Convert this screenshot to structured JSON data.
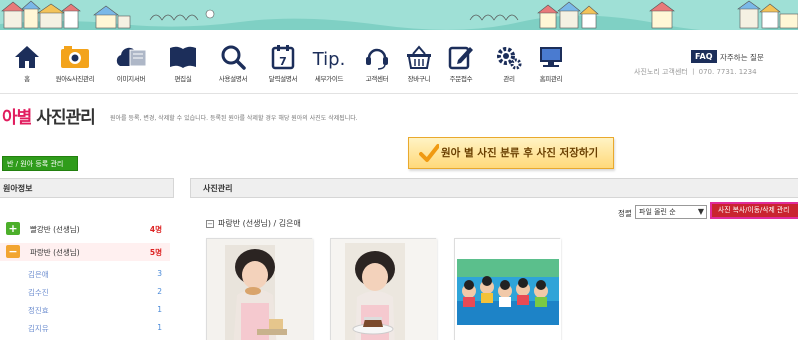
{
  "nav": {
    "items": [
      {
        "label": "홈",
        "icon": "home-icon"
      },
      {
        "label": "원아&사진관리",
        "icon": "camera-icon"
      },
      {
        "label": "이미지서버",
        "icon": "cloud-server-icon"
      },
      {
        "label": "편집실",
        "icon": "book-icon"
      },
      {
        "label": "사용설명서",
        "icon": "magnifier-icon"
      },
      {
        "label": "달력설명서",
        "icon": "calendar-icon"
      },
      {
        "label": "세부가이드",
        "icon": "tip-icon"
      },
      {
        "label": "고객센터",
        "icon": "headset-icon"
      },
      {
        "label": "장바구니",
        "icon": "basket-icon"
      },
      {
        "label": "주문접수",
        "icon": "order-edit-icon"
      },
      {
        "label": "관리",
        "icon": "gears-icon"
      },
      {
        "label": "홈피관리",
        "icon": "monitor-icon"
      }
    ],
    "calendar_day": "7",
    "tip_text": "Tip."
  },
  "faq": {
    "badge": "FAQ",
    "text": "자주하는 질문",
    "support": "사진노리 고객센터 ㅣ 070. 7731. 1234"
  },
  "page": {
    "title_accent": "아별",
    "title_main": " 사진관리",
    "description": "원아를 등록, 변경, 삭제할 수 있습니다. 등록된 원아를 삭제할 경우 해당 원아의 사진도 삭제됩니다."
  },
  "register_button": "반 / 원아 등록 관리",
  "save_banner": "원아 별 사진 분류 후 사진 저장하기",
  "left_panel": {
    "header": "원아정보",
    "classes": [
      {
        "name": "빨강반 (선생님)",
        "count": "4명",
        "toggle": "+",
        "color": "#4caf2a"
      },
      {
        "name": "파랑반 (선생님)",
        "count": "5명",
        "toggle": "−",
        "color": "#f2a531"
      }
    ],
    "children": [
      {
        "name": "김은애",
        "count": "3"
      },
      {
        "name": "김수진",
        "count": "2"
      },
      {
        "name": "정진효",
        "count": "1"
      },
      {
        "name": "김지유",
        "count": "1"
      }
    ]
  },
  "right_panel": {
    "header": "사진관리",
    "sort_label": "정렬",
    "sort_value": "파일 올린 순",
    "copy_move_button": "사진 복사/이동/삭제 관리",
    "folder_toggle": "−",
    "folder_title": "파랑반 (선생님) / 김은애"
  },
  "colors": {
    "accent_title": "#e11d5e",
    "green_button": "#2f9c1b",
    "red_button": "#c9242f",
    "banner_sky": "#9fe0d6"
  }
}
